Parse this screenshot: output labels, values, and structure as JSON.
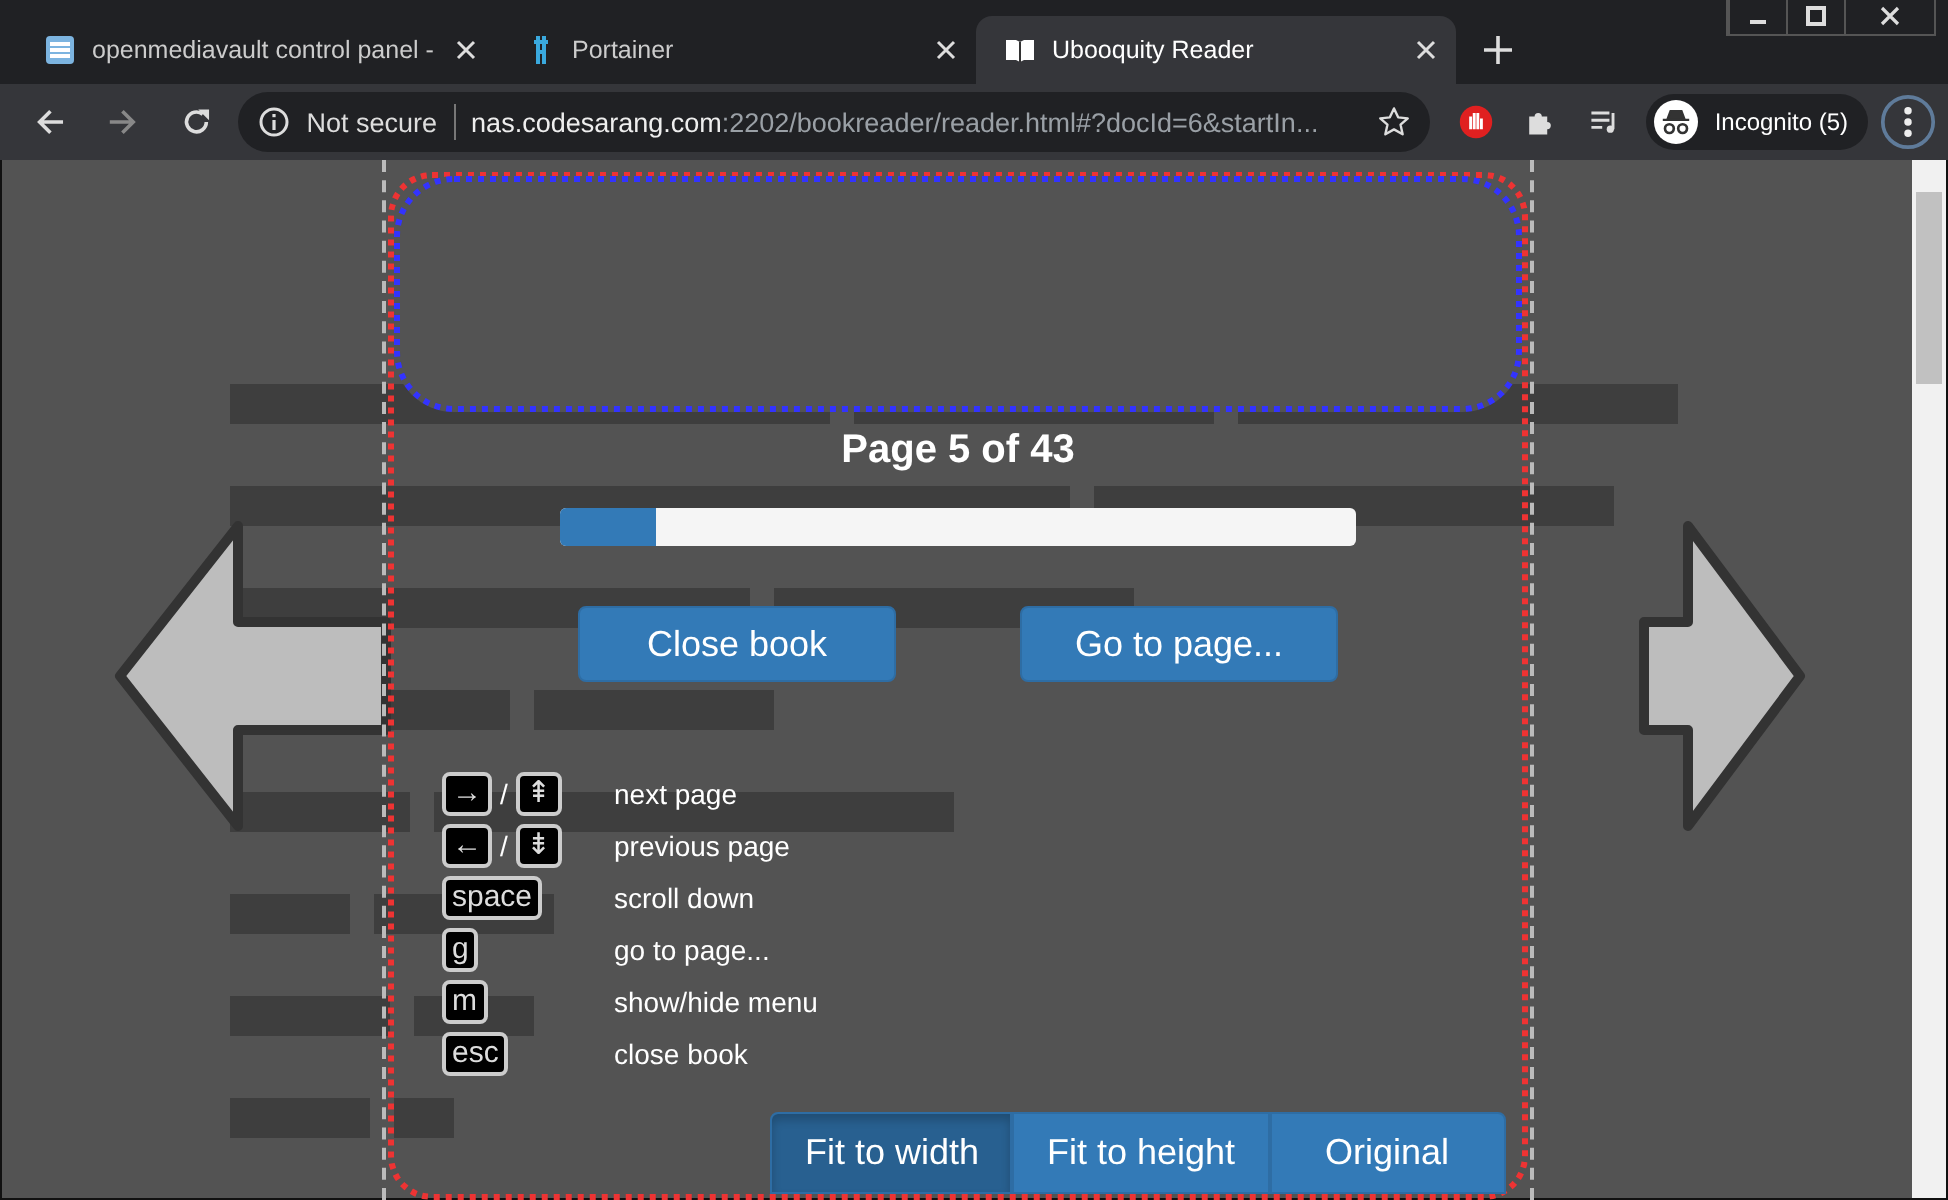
{
  "tabs": [
    {
      "title": "openmediavault control panel -",
      "selected": false
    },
    {
      "title": "Portainer",
      "selected": false
    },
    {
      "title": "Ubooquity Reader",
      "selected": true
    }
  ],
  "address_bar": {
    "security": "Not secure",
    "host": "nas.codesarang.com",
    "path": ":2202/bookreader/reader.html#?docId=6&startIn..."
  },
  "profile": {
    "label": "Incognito (5)"
  },
  "reader": {
    "page_label": "Page 5 of 43",
    "progress": {
      "level": 0.12
    },
    "buttons": [
      "Close book",
      "Go to page..."
    ],
    "shortcuts": [
      {
        "keys": [
          "→",
          "⇞"
        ],
        "separator": "/",
        "label": "next page"
      },
      {
        "keys": [
          "←",
          "⇟"
        ],
        "separator": "/",
        "label": "previous page"
      },
      {
        "keys": [
          "space"
        ],
        "label": "scroll down"
      },
      {
        "keys": [
          "g"
        ],
        "label": "go to page..."
      },
      {
        "keys": [
          "m"
        ],
        "label": "show/hide menu"
      },
      {
        "keys": [
          "esc"
        ],
        "label": "close book"
      }
    ],
    "fit_modes": [
      {
        "label": "Fit to width",
        "selected": true
      },
      {
        "label": "Fit to height",
        "selected": false
      },
      {
        "label": "Original",
        "selected": false
      }
    ]
  }
}
